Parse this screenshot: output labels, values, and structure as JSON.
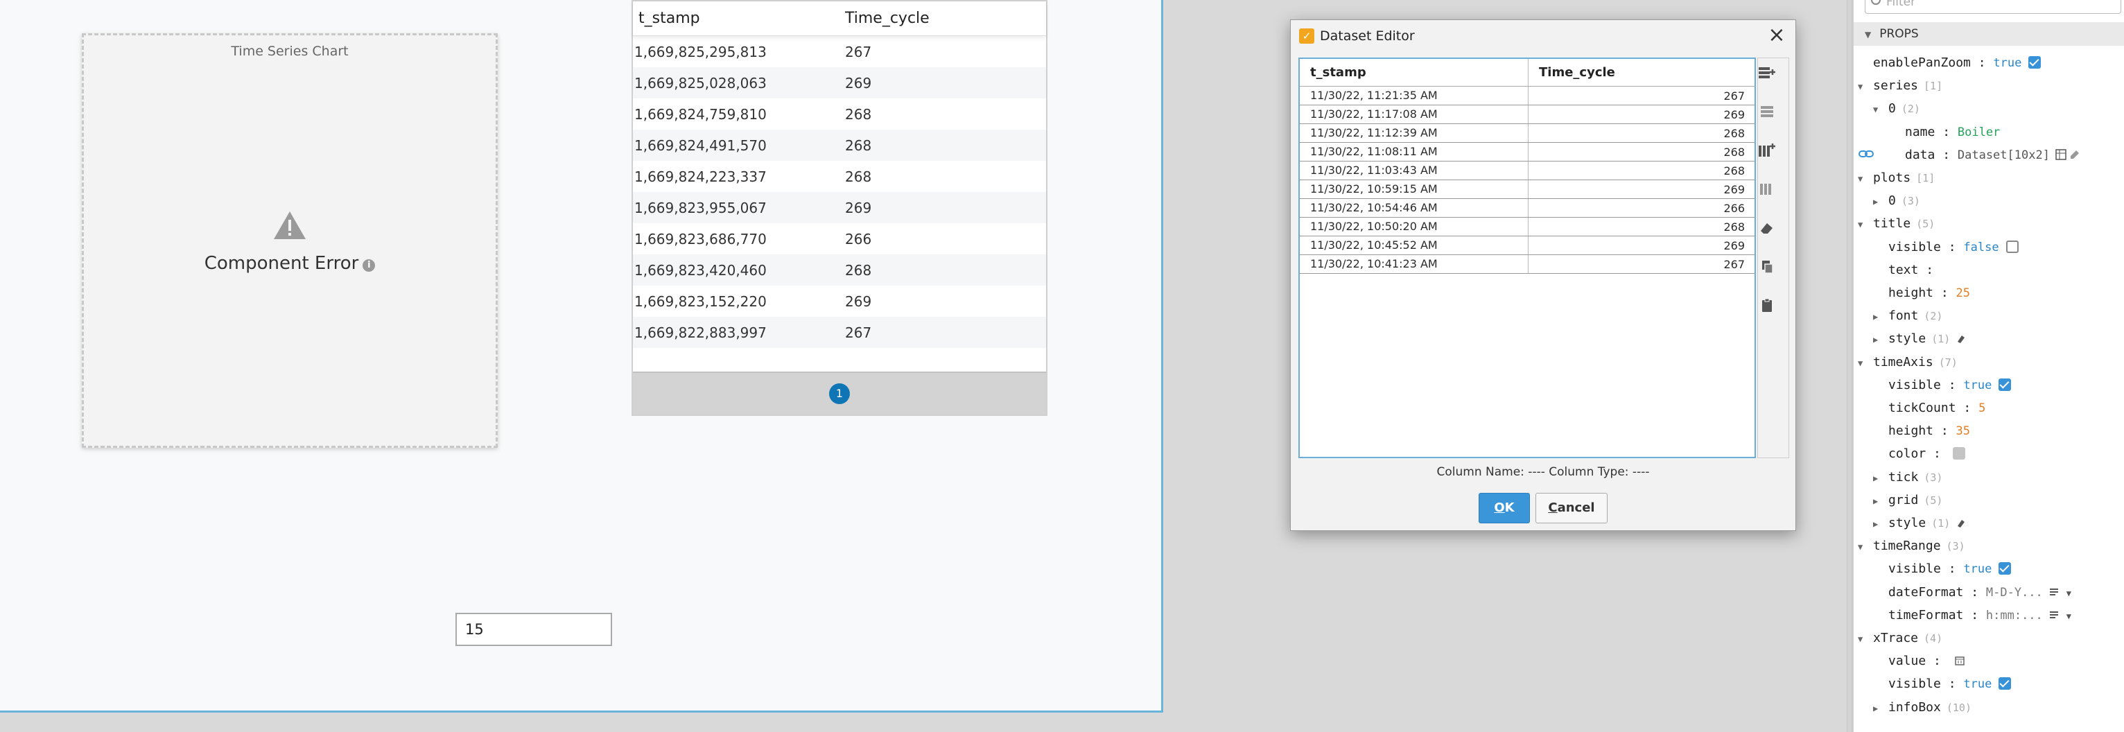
{
  "chart": {
    "title": "Time Series Chart",
    "error_text": "Component Error"
  },
  "table": {
    "columns": [
      "t_stamp",
      "Time_cycle"
    ],
    "rows": [
      [
        "1,669,825,295,813",
        "267"
      ],
      [
        "1,669,825,028,063",
        "269"
      ],
      [
        "1,669,824,759,810",
        "268"
      ],
      [
        "1,669,824,491,570",
        "268"
      ],
      [
        "1,669,824,223,337",
        "268"
      ],
      [
        "1,669,823,955,067",
        "269"
      ],
      [
        "1,669,823,686,770",
        "266"
      ],
      [
        "1,669,823,420,460",
        "268"
      ],
      [
        "1,669,823,152,220",
        "269"
      ],
      [
        "1,669,822,883,997",
        "267"
      ]
    ],
    "page": "1"
  },
  "numeric_field": {
    "value": "15"
  },
  "dialog": {
    "title": "Dataset Editor",
    "columns": [
      "t_stamp",
      "Time_cycle"
    ],
    "rows": [
      [
        "11/30/22, 11:21:35 AM",
        "267"
      ],
      [
        "11/30/22, 11:17:08 AM",
        "269"
      ],
      [
        "11/30/22, 11:12:39 AM",
        "268"
      ],
      [
        "11/30/22, 11:08:11 AM",
        "268"
      ],
      [
        "11/30/22, 11:03:43 AM",
        "268"
      ],
      [
        "11/30/22, 10:59:15 AM",
        "269"
      ],
      [
        "11/30/22, 10:54:46 AM",
        "266"
      ],
      [
        "11/30/22, 10:50:20 AM",
        "268"
      ],
      [
        "11/30/22, 10:45:52 AM",
        "269"
      ],
      [
        "11/30/22, 10:41:23 AM",
        "267"
      ]
    ],
    "column_info": "Column Name: ----  Column Type: ----",
    "ok_label": "OK",
    "cancel_label": "Cancel",
    "tools": [
      "add-row-icon",
      "delete-row-icon",
      "add-column-icon",
      "delete-column-icon",
      "clear-icon",
      "copy-icon",
      "paste-icon"
    ]
  },
  "props": {
    "filter_placeholder": "Filter",
    "section_label": "PROPS",
    "rows": [
      {
        "key": "enablePanZoom",
        "val": "true",
        "type": "bool",
        "check": "on",
        "level": 1
      },
      {
        "key": "series",
        "count": "[1]",
        "expand": "open",
        "level": 1
      },
      {
        "key": "0",
        "count": "(2)",
        "expand": "open",
        "level": 2
      },
      {
        "key": "name",
        "val": "Boiler",
        "type": "str",
        "level": 3
      },
      {
        "key": "data",
        "val": "Dataset[10x2]",
        "type": "ds",
        "level": 3,
        "icons": true
      },
      {
        "key": "plots",
        "count": "[1]",
        "expand": "open",
        "level": 1
      },
      {
        "key": "0",
        "count": "(3)",
        "expand": "closed",
        "level": 2
      },
      {
        "key": "title",
        "count": "(5)",
        "expand": "open",
        "level": 1
      },
      {
        "key": "visible",
        "val": "false",
        "type": "bool",
        "check": "off",
        "level": 2
      },
      {
        "key": "text",
        "val": "",
        "type": "str",
        "level": 2
      },
      {
        "key": "height",
        "val": "25",
        "type": "num",
        "level": 2
      },
      {
        "key": "font",
        "count": "(2)",
        "expand": "closed",
        "level": 2
      },
      {
        "key": "style",
        "count": "(1)",
        "expand": "closed",
        "level": 2,
        "brush": true
      },
      {
        "key": "timeAxis",
        "count": "(7)",
        "expand": "open",
        "level": 1
      },
      {
        "key": "visible",
        "val": "true",
        "type": "bool",
        "check": "on",
        "level": 2
      },
      {
        "key": "tickCount",
        "val": "5",
        "type": "num",
        "level": 2
      },
      {
        "key": "height",
        "val": "35",
        "type": "num",
        "level": 2
      },
      {
        "key": "color",
        "val": "",
        "type": "color",
        "level": 2
      },
      {
        "key": "tick",
        "count": "(3)",
        "expand": "closed",
        "level": 2
      },
      {
        "key": "grid",
        "count": "(5)",
        "expand": "closed",
        "level": 2
      },
      {
        "key": "style",
        "count": "(1)",
        "expand": "closed",
        "level": 2,
        "brush": true
      },
      {
        "key": "timeRange",
        "count": "(3)",
        "expand": "open",
        "level": 1
      },
      {
        "key": "visible",
        "val": "true",
        "type": "bool",
        "check": "on",
        "level": 2
      },
      {
        "key": "dateFormat",
        "val": "M-D-Y...",
        "type": "fmt",
        "level": 2,
        "dropdown": true
      },
      {
        "key": "timeFormat",
        "val": "h:mm:...",
        "type": "fmt",
        "level": 2,
        "dropdown": true
      },
      {
        "key": "xTrace",
        "count": "(4)",
        "expand": "open",
        "level": 1
      },
      {
        "key": "value",
        "val": "",
        "type": "cal",
        "level": 2
      },
      {
        "key": "visible",
        "val": "true",
        "type": "bool",
        "check": "on",
        "level": 2
      },
      {
        "key": "infoBox",
        "count": "(10)",
        "expand": "closed",
        "level": 2
      }
    ]
  }
}
